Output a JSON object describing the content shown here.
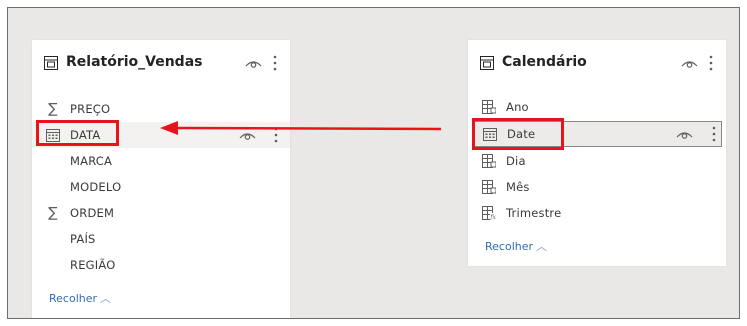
{
  "tables": [
    {
      "title": "Relatório_Vendas",
      "fields": [
        {
          "label": "PREÇO",
          "icon": "sigma-icon"
        },
        {
          "label": "DATA",
          "icon": "calendar-icon"
        },
        {
          "label": "MARCA",
          "icon": ""
        },
        {
          "label": "MODELO",
          "icon": ""
        },
        {
          "label": "ORDEM",
          "icon": "sigma-icon"
        },
        {
          "label": "PAÍS",
          "icon": ""
        },
        {
          "label": "REGIÃO",
          "icon": ""
        }
      ],
      "collapse_label": "Recolher"
    },
    {
      "title": "Calendário",
      "fields": [
        {
          "label": "Ano",
          "icon": "calculated-column-icon"
        },
        {
          "label": "Date",
          "icon": "calendar-icon"
        },
        {
          "label": "Dia",
          "icon": "calculated-column-icon"
        },
        {
          "label": "Mês",
          "icon": "calculated-column-icon"
        },
        {
          "label": "Trimestre",
          "icon": "calculated-column-fx-icon"
        }
      ],
      "collapse_label": "Recolher"
    }
  ],
  "colors": {
    "canvas_bg": "#e9e8e7",
    "annotation_red": "#e8141c",
    "link_blue": "#2f6eb5"
  }
}
